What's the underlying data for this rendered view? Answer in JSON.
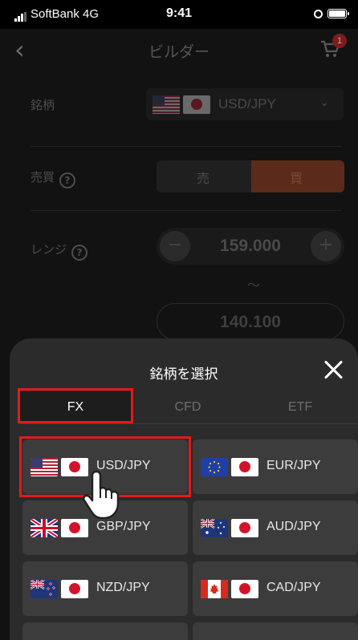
{
  "status_bar": {
    "carrier": "SoftBank",
    "network": "4G",
    "time": "9:41"
  },
  "nav": {
    "back_icon": "chevron-left-icon",
    "title": "ビルダー",
    "cart_badge": "1"
  },
  "form": {
    "symbol_label": "銘柄",
    "symbol_value": "USD/JPY",
    "side_label": "売買",
    "sell_label": "売",
    "buy_label": "買",
    "range_label": "レンジ",
    "range_upper": "159.000",
    "range_separator": "〜",
    "range_lower": "140.100"
  },
  "sheet": {
    "title": "銘柄を選択",
    "tabs": [
      {
        "label": "FX"
      },
      {
        "label": "CFD"
      },
      {
        "label": "ETF"
      }
    ],
    "active_tab": "FX",
    "pairs": [
      {
        "label": "USD/JPY",
        "base_flag": "us-flag"
      },
      {
        "label": "EUR/JPY",
        "base_flag": "eu-flag"
      },
      {
        "label": "GBP/JPY",
        "base_flag": "uk-flag"
      },
      {
        "label": "AUD/JPY",
        "base_flag": "au-flag"
      },
      {
        "label": "NZD/JPY",
        "base_flag": "nz-flag"
      },
      {
        "label": "CAD/JPY",
        "base_flag": "ca-flag"
      }
    ]
  },
  "colors": {
    "accent": "#e21b1b",
    "buy": "#5b2a1a",
    "sheet_bg": "#2b2b2b"
  }
}
